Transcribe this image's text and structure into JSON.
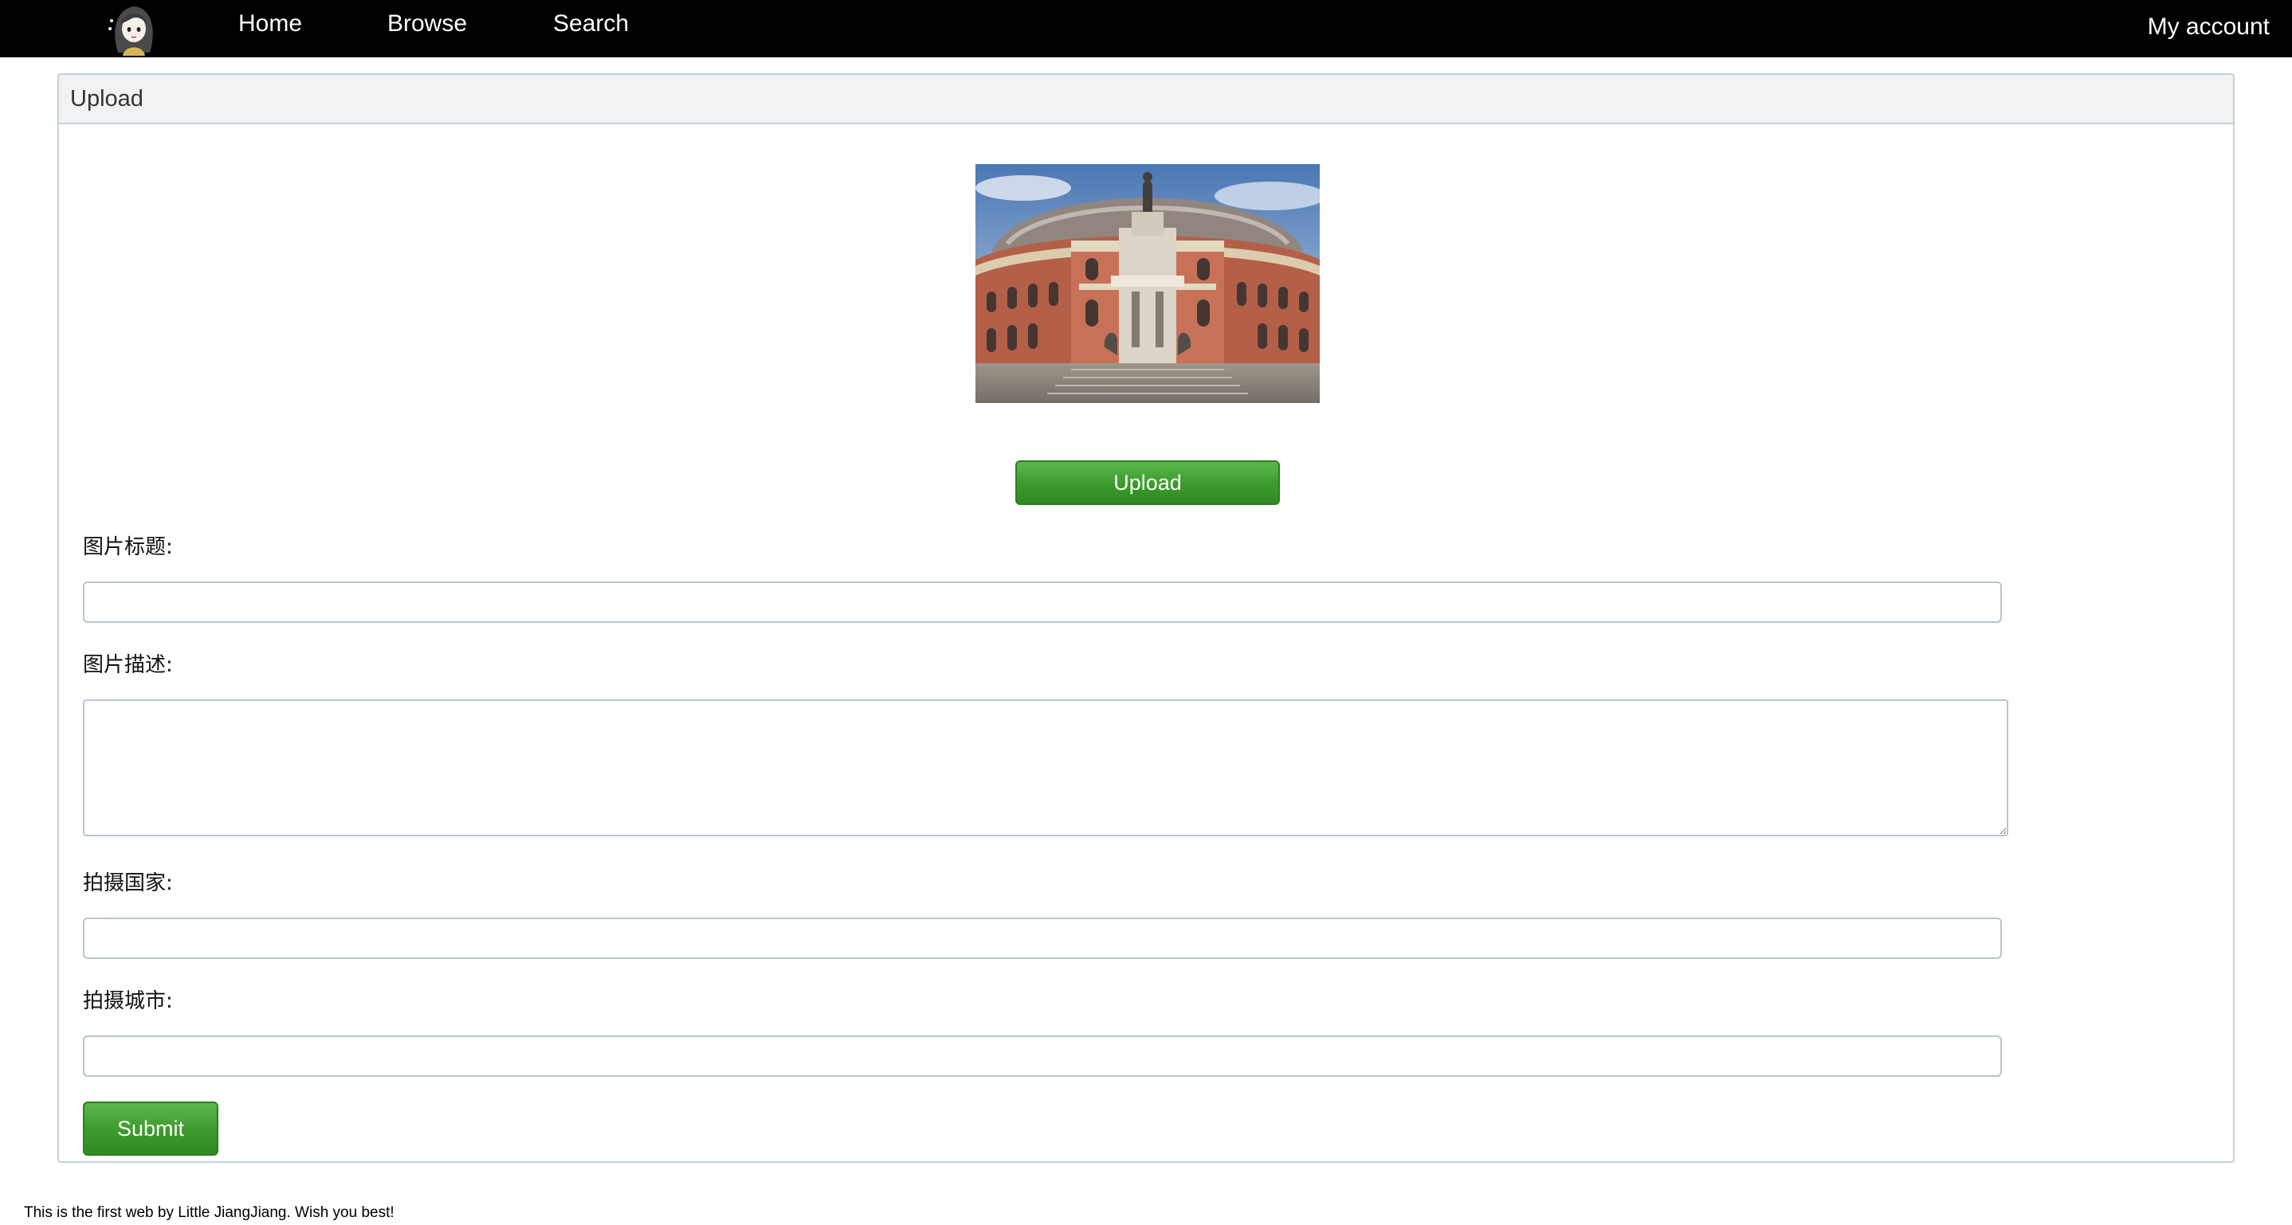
{
  "nav": {
    "home": "Home",
    "browse": "Browse",
    "search": "Search",
    "account": "My account"
  },
  "panel": {
    "title": "Upload"
  },
  "preview": {
    "alt": "Photo of a domed red-brick concert hall with a statue monument in front",
    "icon": "image-preview"
  },
  "form": {
    "upload_label": "Upload",
    "title_label": "图片标题:",
    "title_value": "",
    "desc_label": "图片描述:",
    "desc_value": "",
    "country_label": "拍摄国家:",
    "country_value": "",
    "city_label": "拍摄城市:",
    "city_value": "",
    "submit_label": "Submit"
  },
  "footer": {
    "text": "This is the first web by Little JiangJiang. Wish you best!"
  },
  "colors": {
    "nav_background": "#000000",
    "button_green": "#3c9a2c",
    "panel_header": "#f2f2f2",
    "border": "#c4cfdc"
  }
}
